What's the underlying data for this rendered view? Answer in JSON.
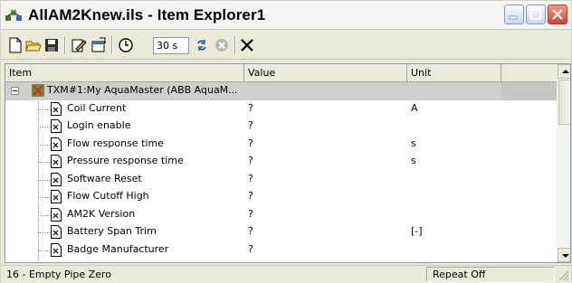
{
  "window": {
    "title": "AllAM2Knew.ils - Item Explorer1",
    "controls": {
      "minimize": "minimize-icon",
      "maximize": "maximize-icon",
      "close": "close-icon"
    }
  },
  "toolbar": {
    "buttons": [
      {
        "name": "new-button",
        "icon": "new-document-icon"
      },
      {
        "name": "open-button",
        "icon": "open-folder-icon"
      },
      {
        "name": "save-button",
        "icon": "floppy-disk-icon"
      },
      {
        "name": "edit-button",
        "icon": "edit-icon"
      },
      {
        "name": "properties-button",
        "icon": "properties-icon"
      },
      {
        "name": "timer-button",
        "icon": "clock-icon"
      }
    ],
    "interval_value": "30 s",
    "refresh_icon": "refresh-icon",
    "stop_icon": "stop-icon",
    "delete_icon": "delete-x-icon"
  },
  "grid": {
    "columns": [
      {
        "label": "Item"
      },
      {
        "label": "Value"
      },
      {
        "label": "Unit"
      }
    ],
    "root": {
      "label": "TXM#1:My AquaMaster (ABB AquaM..."
    },
    "rows": [
      {
        "label": "Coil Current",
        "value": "?",
        "unit": "A"
      },
      {
        "label": "Login enable",
        "value": "?",
        "unit": ""
      },
      {
        "label": "Flow response time",
        "value": "?",
        "unit": "s"
      },
      {
        "label": "Pressure response time",
        "value": "?",
        "unit": "s"
      },
      {
        "label": "Software Reset",
        "value": "?",
        "unit": ""
      },
      {
        "label": "Flow Cutoff High",
        "value": "?",
        "unit": ""
      },
      {
        "label": "AM2K Version",
        "value": "?",
        "unit": ""
      },
      {
        "label": "Battery Span Trim",
        "value": "?",
        "unit": "[-]"
      },
      {
        "label": "Badge Manufacturer",
        "value": "?",
        "unit": ""
      }
    ]
  },
  "statusbar": {
    "left": "16 - Empty Pipe Zero",
    "right": "Repeat Off"
  }
}
